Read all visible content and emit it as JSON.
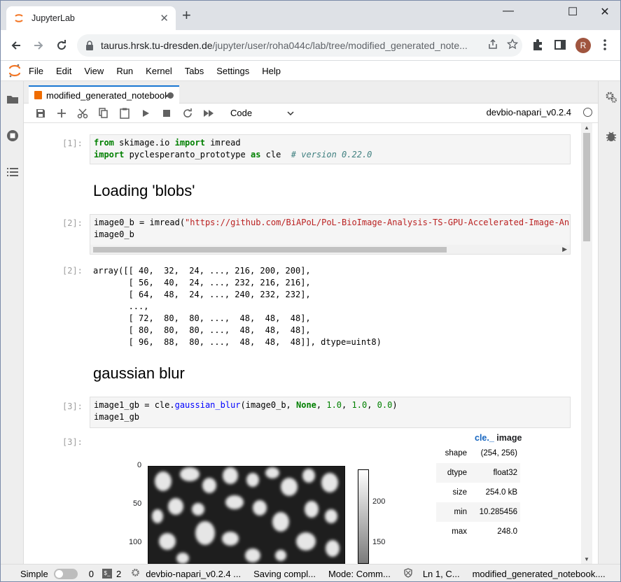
{
  "browser": {
    "tab_title": "JupyterLab",
    "tab_close": "✕",
    "new_tab": "+",
    "minimize": "—",
    "maximize": "☐",
    "close": "✕",
    "url_host": "taurus.hrsk.tu-dresden.de",
    "url_path": "/jupyter/user/roha044c/lab/tree/modified_generated_note...",
    "avatar_letter": "R"
  },
  "menu": [
    "File",
    "Edit",
    "View",
    "Run",
    "Kernel",
    "Tabs",
    "Settings",
    "Help"
  ],
  "document": {
    "tab_name": "modified_generated_notebook",
    "cell_type": "Code",
    "kernel": "devbio-napari_v0.2.4"
  },
  "cells": {
    "c1_prompt": "[1]:",
    "c1_line1": [
      "from",
      " skimage.io ",
      "import",
      " imread"
    ],
    "c1_line2": [
      "import",
      " pyclesperanto_prototype ",
      "as",
      " cle  ",
      "# version 0.22.0"
    ],
    "h_loading": "Loading 'blobs'",
    "c2_prompt": "[2]:",
    "c2_line1_a": "image0_b = imread(",
    "c2_line1_str": "\"https://github.com/BiAPoL/PoL-BioImage-Analysis-TS-GPU-Accelerated-Image-Anal",
    "c2_line2": "image0_b",
    "o2_prompt": "[2]:",
    "o2_text": "array([[ 40,  32,  24, ..., 216, 200, 200],\n       [ 56,  40,  24, ..., 232, 216, 216],\n       [ 64,  48,  24, ..., 240, 232, 232],\n       ...,\n       [ 72,  80,  80, ...,  48,  48,  48],\n       [ 80,  80,  80, ...,  48,  48,  48],\n       [ 96,  88,  80, ...,  48,  48,  48]], dtype=uint8)",
    "h_gauss": "gaussian blur",
    "c3_prompt": "[3]:",
    "c3_a": "image1_gb = cle.",
    "c3_fn": "gaussian_blur",
    "c3_b": "(image0_b, ",
    "c3_none": "None",
    "c3_c": ", ",
    "c3_n1": "1.0",
    "c3_n2": "1.0",
    "c3_n3": "0.0",
    "c3_d": ")",
    "c3_line2": "image1_gb",
    "o3_prompt": "[3]:"
  },
  "image_output": {
    "yticks": [
      "0",
      "50",
      "100"
    ],
    "cbar_ticks": [
      "200",
      "150"
    ]
  },
  "cle_image": {
    "header_prefix": "cle._",
    "header_suffix": " image",
    "rows": [
      {
        "key": "shape",
        "value": "(254, 256)"
      },
      {
        "key": "dtype",
        "value": "float32"
      },
      {
        "key": "size",
        "value": "254.0 kB"
      },
      {
        "key": "min",
        "value": "10.285456"
      },
      {
        "key": "max",
        "value": "248.0"
      }
    ]
  },
  "statusbar": {
    "mode_label": "Simple",
    "count1": "0",
    "count2": "2",
    "kernel": "devbio-napari_v0.2.4 ...",
    "saving": "Saving compl...",
    "mode": "Mode: Comm...",
    "position": "Ln 1, C...",
    "file": "modified_generated_notebook...."
  }
}
